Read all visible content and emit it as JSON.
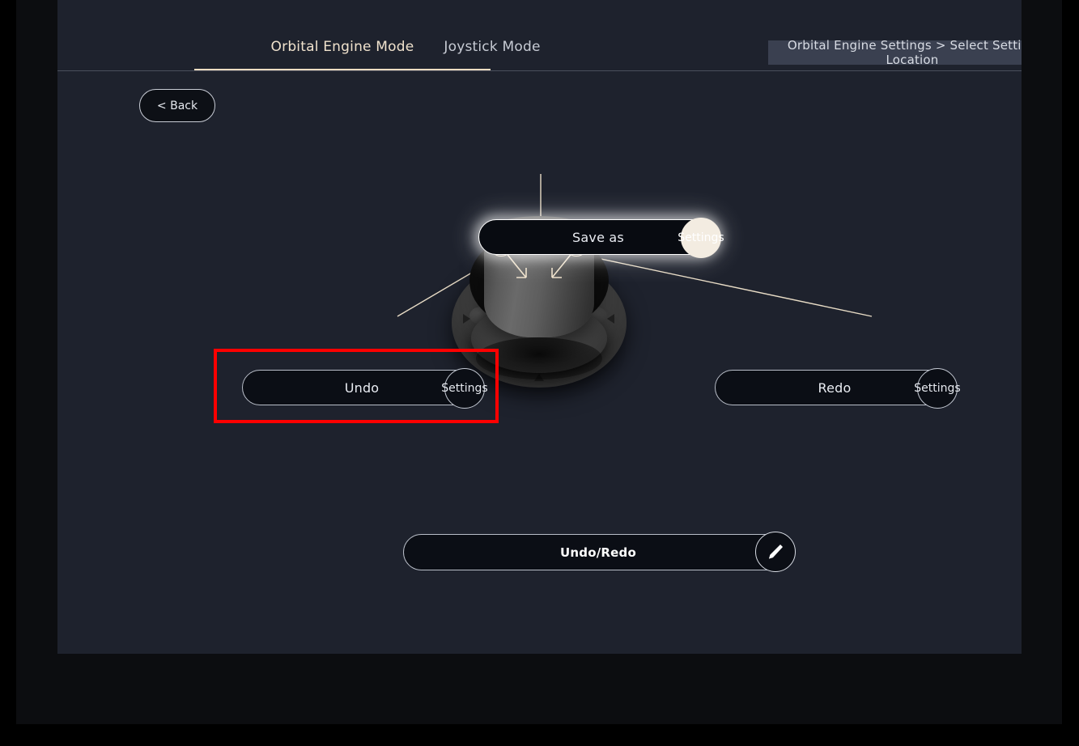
{
  "window": {
    "panel_background": "#1e222d",
    "chrome_background": "#0c0d10"
  },
  "tabs": [
    {
      "label": "Orbital Engine Mode",
      "active": true
    },
    {
      "label": "Joystick Mode",
      "active": false
    }
  ],
  "breadcrumb": {
    "text": "Orbital Engine Settings > Select Setting Location",
    "help_icon": "question-mark-icon",
    "help_glyph": "?",
    "background": "#3a4050"
  },
  "back_button": {
    "label": "< Back"
  },
  "dial": {
    "name": "orbital-engine-dial",
    "markers": {
      "left": "▷",
      "right": "◁",
      "bottom": "△"
    },
    "nodes": [
      {
        "id": "left-node",
        "label": ""
      },
      {
        "id": "center-node",
        "label": ""
      },
      {
        "id": "right-node",
        "label": ""
      }
    ]
  },
  "pills": {
    "save_as": {
      "label": "Save as",
      "badge": "Settings",
      "badge_style": "filled",
      "highlighted": true
    },
    "undo": {
      "label": "Undo",
      "badge": "Settings",
      "badge_style": "outline",
      "highlighted": false
    },
    "redo": {
      "label": "Redo",
      "badge": "Settings",
      "badge_style": "outline",
      "highlighted": false
    },
    "undo_redo": {
      "label": "Undo/Redo",
      "badge_icon": "pencil-icon"
    }
  },
  "annotation": {
    "highlight_color": "#ff0000",
    "target": "undo-pill"
  },
  "colors": {
    "accent_cream": "#f0ddc2",
    "panel": "#1e222d",
    "pill_fill": "#0b0e15",
    "text_primary": "#e9ecf2",
    "text_muted": "#c7cbd4"
  }
}
